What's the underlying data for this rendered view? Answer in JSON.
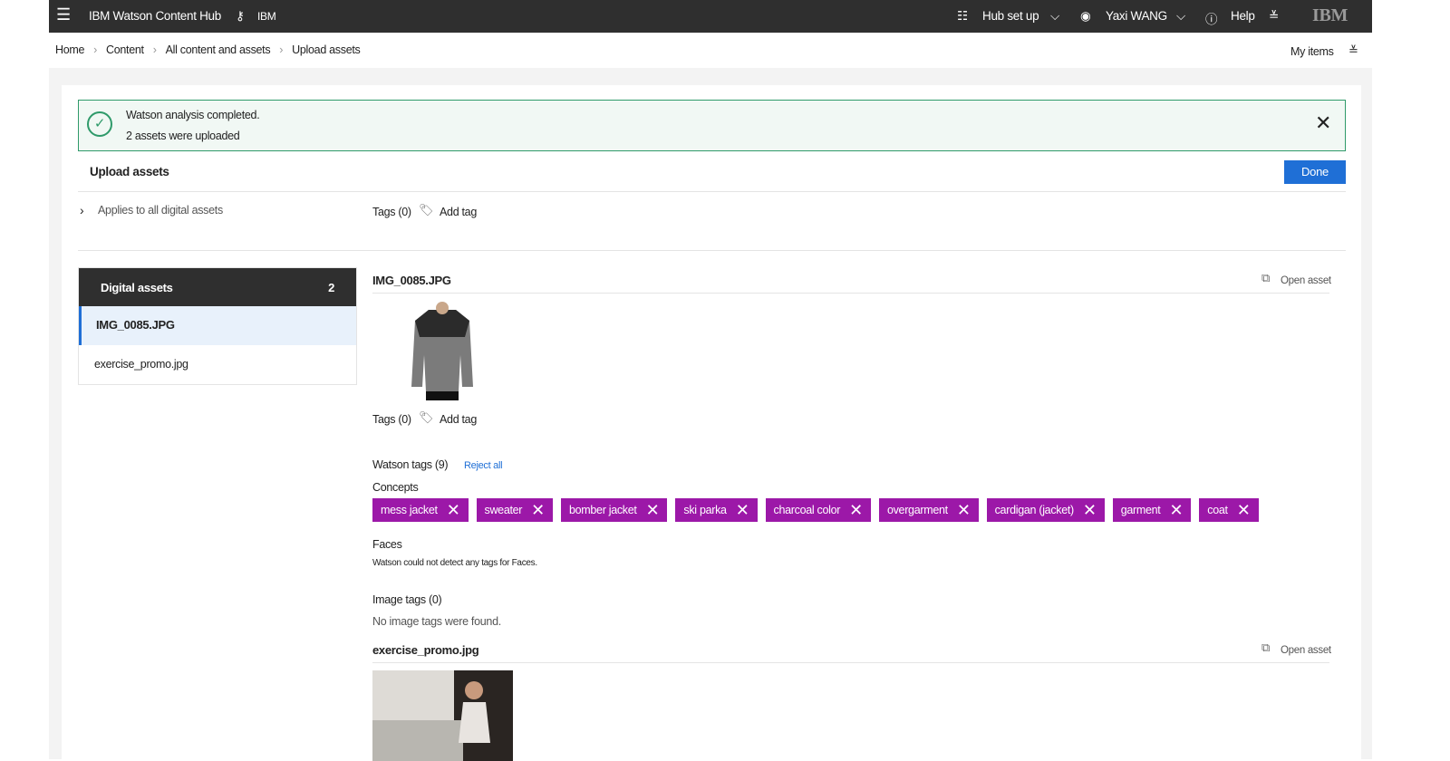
{
  "topbar": {
    "app_title": "IBM Watson Content Hub",
    "tenant": "IBM",
    "hub_setup": "Hub set up",
    "user": "Yaxi WANG",
    "help": "Help",
    "logo": "IBM"
  },
  "breadcrumb": [
    "Home",
    "Content",
    "All content and assets",
    "Upload assets"
  ],
  "my_items": "My items",
  "notification": {
    "title": "Watson analysis completed.",
    "subtitle": "2 assets were uploaded"
  },
  "page_title": "Upload assets",
  "done_label": "Done",
  "applies_label": "Applies to all digital assets",
  "global_tags": {
    "label": "Tags (0)",
    "add": "Add tag"
  },
  "sidebar": {
    "header": "Digital assets",
    "count": "2",
    "items": [
      "IMG_0085.JPG",
      "exercise_promo.jpg"
    ]
  },
  "assets": [
    {
      "name": "IMG_0085.JPG",
      "open": "Open asset",
      "tags_label": "Tags (0)",
      "add_tag": "Add tag",
      "watson_tags": "Watson tags (9)",
      "reject_all": "Reject all",
      "concepts_label": "Concepts",
      "concepts": [
        "mess jacket",
        "sweater",
        "bomber jacket",
        "ski parka",
        "charcoal color",
        "overgarment",
        "cardigan (jacket)",
        "garment",
        "coat"
      ],
      "faces_label": "Faces",
      "faces_msg": "Watson could not detect any tags for Faces.",
      "image_tags": "Image tags (0)",
      "image_tags_msg": "No image tags were found."
    },
    {
      "name": "exercise_promo.jpg",
      "open": "Open asset"
    }
  ],
  "colors": {
    "tag": "#9c18a8",
    "done": "#1f6fd6",
    "success": "#2f9a6a"
  }
}
